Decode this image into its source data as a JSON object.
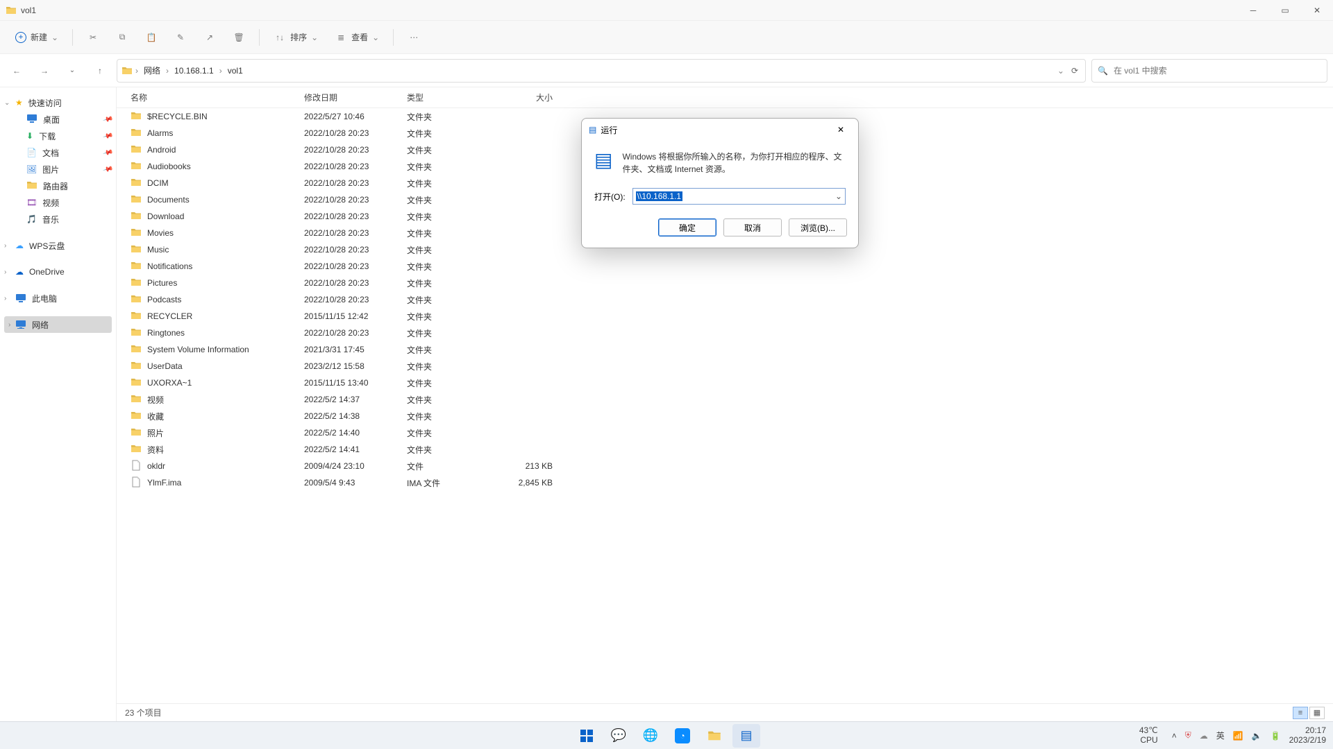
{
  "window": {
    "title": "vol1"
  },
  "toolbar": {
    "new": "新建",
    "sort": "排序",
    "view": "查看"
  },
  "nav": {
    "breadcrumb": [
      "网络",
      "10.168.1.1",
      "vol1"
    ],
    "search_placeholder": "在 vol1 中搜索"
  },
  "sidebar": {
    "quick": {
      "label": "快速访问",
      "items": [
        {
          "label": "桌面",
          "icon": "desktop",
          "pin": true
        },
        {
          "label": "下载",
          "icon": "download",
          "pin": true
        },
        {
          "label": "文档",
          "icon": "doc",
          "pin": true
        },
        {
          "label": "图片",
          "icon": "picture",
          "pin": true
        },
        {
          "label": "路由器",
          "icon": "folder",
          "pin": false
        },
        {
          "label": "视频",
          "icon": "video",
          "pin": false
        },
        {
          "label": "音乐",
          "icon": "music",
          "pin": false
        }
      ]
    },
    "wps": {
      "label": "WPS云盘"
    },
    "onedrive": {
      "label": "OneDrive"
    },
    "thispc": {
      "label": "此电脑"
    },
    "network": {
      "label": "网络"
    }
  },
  "columns": {
    "name": "名称",
    "date": "修改日期",
    "type": "类型",
    "size": "大小"
  },
  "files": [
    {
      "name": "$RECYCLE.BIN",
      "date": "2022/5/27 10:46",
      "type": "文件夹",
      "size": "",
      "icon": "folder"
    },
    {
      "name": "Alarms",
      "date": "2022/10/28 20:23",
      "type": "文件夹",
      "size": "",
      "icon": "folder"
    },
    {
      "name": "Android",
      "date": "2022/10/28 20:23",
      "type": "文件夹",
      "size": "",
      "icon": "folder"
    },
    {
      "name": "Audiobooks",
      "date": "2022/10/28 20:23",
      "type": "文件夹",
      "size": "",
      "icon": "folder"
    },
    {
      "name": "DCIM",
      "date": "2022/10/28 20:23",
      "type": "文件夹",
      "size": "",
      "icon": "folder"
    },
    {
      "name": "Documents",
      "date": "2022/10/28 20:23",
      "type": "文件夹",
      "size": "",
      "icon": "folder"
    },
    {
      "name": "Download",
      "date": "2022/10/28 20:23",
      "type": "文件夹",
      "size": "",
      "icon": "folder"
    },
    {
      "name": "Movies",
      "date": "2022/10/28 20:23",
      "type": "文件夹",
      "size": "",
      "icon": "folder"
    },
    {
      "name": "Music",
      "date": "2022/10/28 20:23",
      "type": "文件夹",
      "size": "",
      "icon": "folder"
    },
    {
      "name": "Notifications",
      "date": "2022/10/28 20:23",
      "type": "文件夹",
      "size": "",
      "icon": "folder"
    },
    {
      "name": "Pictures",
      "date": "2022/10/28 20:23",
      "type": "文件夹",
      "size": "",
      "icon": "folder"
    },
    {
      "name": "Podcasts",
      "date": "2022/10/28 20:23",
      "type": "文件夹",
      "size": "",
      "icon": "folder"
    },
    {
      "name": "RECYCLER",
      "date": "2015/11/15 12:42",
      "type": "文件夹",
      "size": "",
      "icon": "folder"
    },
    {
      "name": "Ringtones",
      "date": "2022/10/28 20:23",
      "type": "文件夹",
      "size": "",
      "icon": "folder"
    },
    {
      "name": "System Volume Information",
      "date": "2021/3/31 17:45",
      "type": "文件夹",
      "size": "",
      "icon": "folder"
    },
    {
      "name": "UserData",
      "date": "2023/2/12 15:58",
      "type": "文件夹",
      "size": "",
      "icon": "folder"
    },
    {
      "name": "UXORXA~1",
      "date": "2015/11/15 13:40",
      "type": "文件夹",
      "size": "",
      "icon": "folder"
    },
    {
      "name": "视频",
      "date": "2022/5/2 14:37",
      "type": "文件夹",
      "size": "",
      "icon": "folder"
    },
    {
      "name": "收藏",
      "date": "2022/5/2 14:38",
      "type": "文件夹",
      "size": "",
      "icon": "folder"
    },
    {
      "name": "照片",
      "date": "2022/5/2 14:40",
      "type": "文件夹",
      "size": "",
      "icon": "folder"
    },
    {
      "name": "资料",
      "date": "2022/5/2 14:41",
      "type": "文件夹",
      "size": "",
      "icon": "folder"
    },
    {
      "name": "okldr",
      "date": "2009/4/24 23:10",
      "type": "文件",
      "size": "213 KB",
      "icon": "file"
    },
    {
      "name": "YlmF.ima",
      "date": "2009/5/4 9:43",
      "type": "IMA 文件",
      "size": "2,845 KB",
      "icon": "file"
    }
  ],
  "status": {
    "text": "23 个项目"
  },
  "run_dialog": {
    "title": "运行",
    "desc": "Windows 将根据你所输入的名称，为你打开相应的程序、文件夹、文档或 Internet 资源。",
    "open_label": "打开(O):",
    "value": "\\\\10.168.1.1",
    "ok": "确定",
    "cancel": "取消",
    "browse": "浏览(B)..."
  },
  "systray": {
    "temp": "43℃",
    "cpu": "CPU",
    "ime": "英",
    "time": "20:17",
    "date": "2023/2/19"
  }
}
